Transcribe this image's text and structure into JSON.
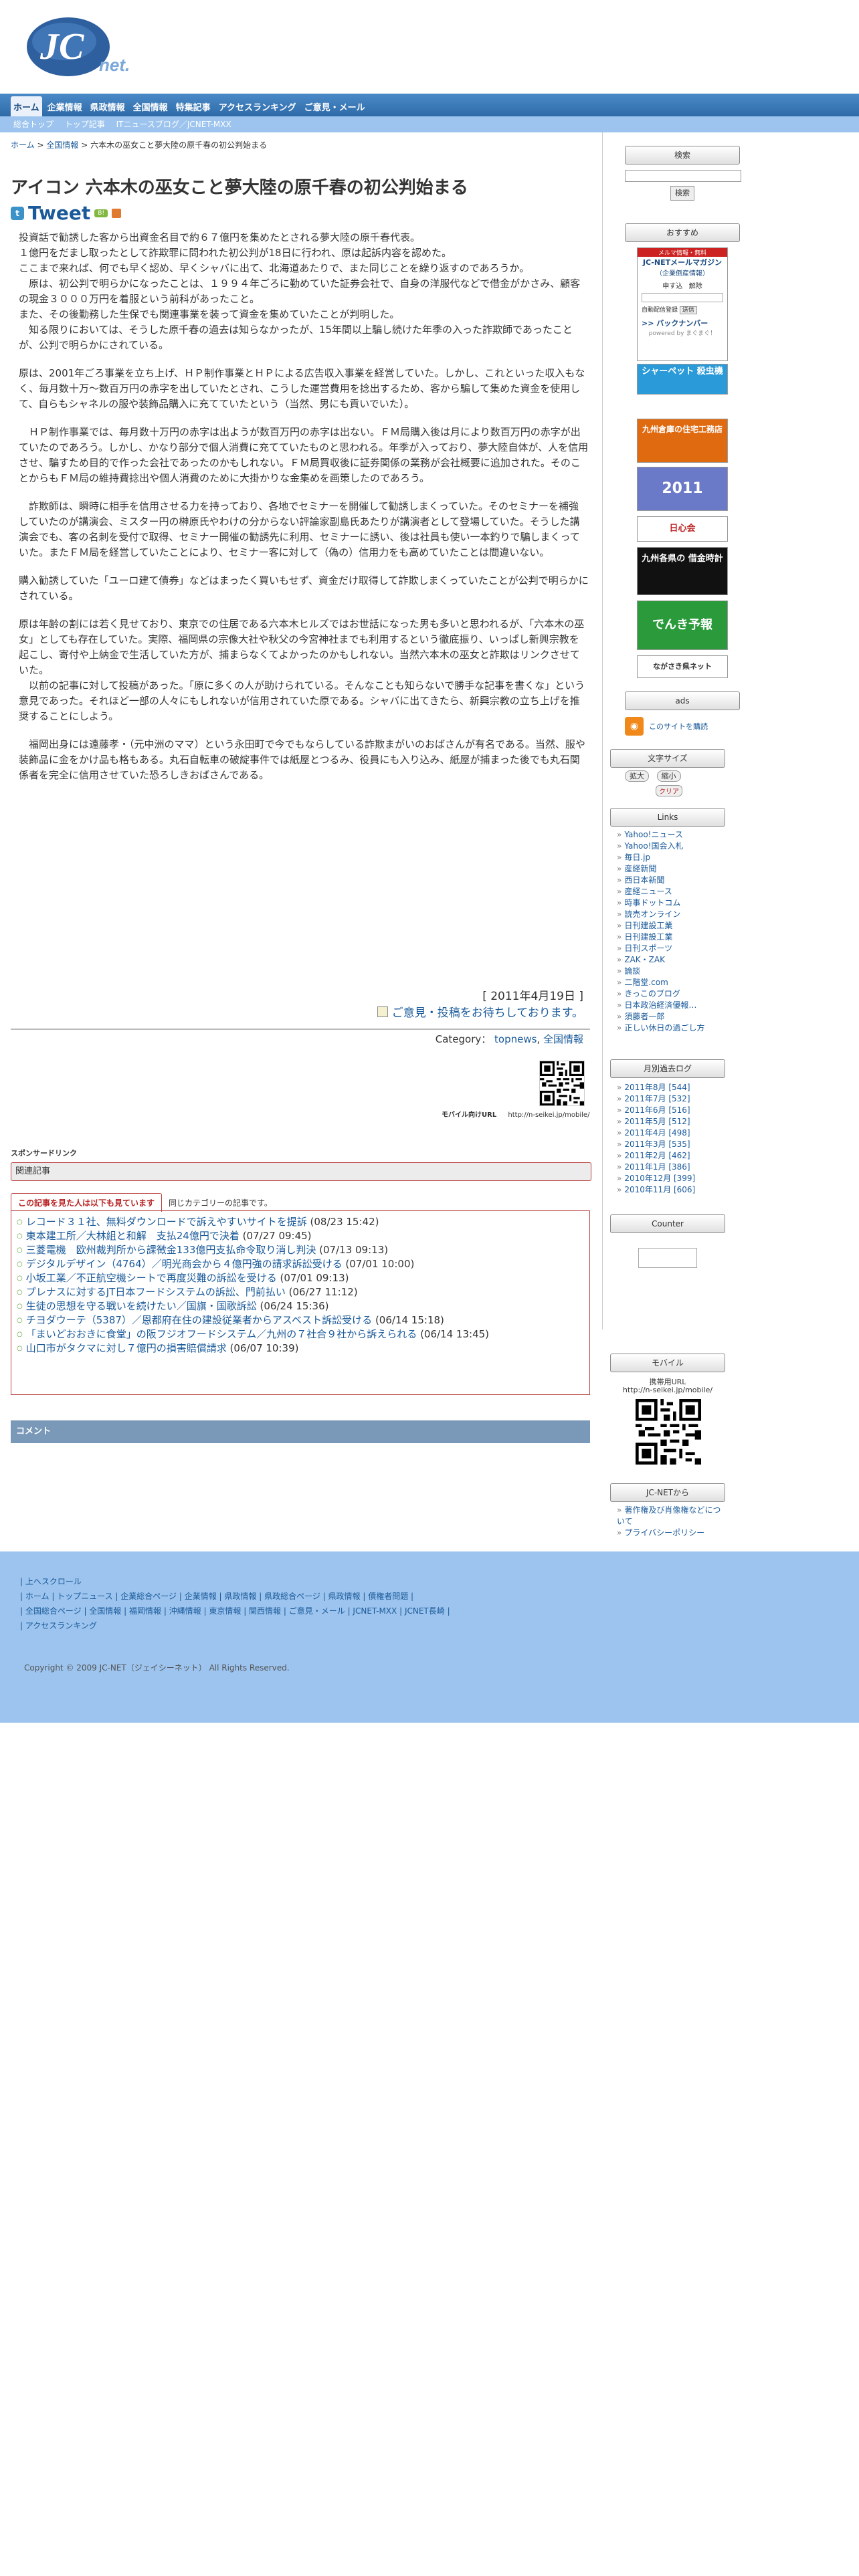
{
  "logo": {
    "text": "JC",
    "sub": "net."
  },
  "nav": {
    "items": [
      "ホーム",
      "企業情報",
      "県政情報",
      "全国情報",
      "特集記事",
      "アクセスランキング",
      "ご意見・メール"
    ]
  },
  "subnav": {
    "items": [
      "総合トップ",
      "トップ記事",
      "ITニュースブログ／JCNET-MXX"
    ]
  },
  "breadcrumb": {
    "home": "ホーム",
    "sep": ">",
    "cat": "全国情報",
    "current": "六本木の巫女こと夢大陸の原千春の初公判始まる"
  },
  "article": {
    "title": "アイコン 六本木の巫女こと夢大陸の原千春の初公判始まる",
    "tweet": "Tweet",
    "paragraphs": [
      "投資話で勧誘した客から出資金名目で約６７億円を集めたとされる夢大陸の原千春代表。\n１億円をだまし取ったとして詐欺罪に問われた初公判が18日に行われ、原は起訴内容を認めた。\nここまで来れば、何でも早く認め、早くシャバに出て、北海道あたりで、また同じことを繰り返すのであろうか。\n　原は、初公判で明らかになったことは、１９９４年ごろに勤めていた証券会社で、自身の洋服代などで借金がかさみ、顧客の現金３０００万円を着服という前科があったこと。\nまた、その後勤務した生保でも関連事業を装って資金を集めていたことが判明した。\n　知る限りにおいては、そうした原千春の過去は知らなかったが、15年間以上騙し続けた年季の入った詐欺師であったことが、公判で明らかにされている。",
      "原は、2001年ごろ事業を立ち上げ、ＨＰ制作事業とＨＰによる広告収入事業を経営していた。しかし、これといった収入もなく、毎月数十万〜数百万円の赤字を出していたとされ、こうした運営費用を捻出するため、客から騙して集めた資金を使用して、自らもシャネルの服や装飾品購入に充てていたという（当然、男にも貢いでいた）。",
      "　ＨＰ制作事業では、毎月数十万円の赤字は出ようが数百万円の赤字は出ない。ＦＭ局購入後は月により数百万円の赤字が出ていたのであろう。しかし、かなり部分で個人消費に充てていたものと思われる。年季が入っており、夢大陸自体が、人を信用させ、騙すため目的で作った会社であったのかもしれない。ＦＭ局買収後に証券関係の業務が会社概要に追加された。そのことからもＦＭ局の維持費捻出や個人消費のために大掛かりな金集めを画策したのであろう。",
      "　詐欺師は、瞬時に相手を信用させる力を持っており、各地でセミナーを開催して勧誘しまくっていた。そのセミナーを補強していたのが講演会、ミスター円の榊原氏やわけの分からない評論家副島氏あたりが講演者として登場していた。そうした講演会でも、客の名刺を受付で取得、セミナー開催の勧誘先に利用、セミナーに誘い、後は社員も使い一本釣りで騙しまくっていた。またＦＭ局を経営していたことにより、セミナー客に対して（偽の）信用力をも高めていたことは間違いない。",
      "購入勧誘していた「ユーロ建て債券」などはまったく買いもせず、資金だけ取得して詐欺しまくっていたことが公判で明らかにされている。",
      "原は年齢の割には若く見せており、東京での住居である六本木ヒルズではお世話になった男も多いと思われるが、「六本木の巫女」としても存在していた。実際、福岡県の宗像大社や秋父の今宮神社までも利用するという徹底振り、いっぱし新興宗教を起こし、寄付や上納金で生活していた方が、捕まらなくてよかったのかもしれない。当然六本木の巫女と詐欺はリンクさせていた。\n　以前の記事に対して投稿があった。「原に多くの人が助けられている。そんなことも知らないで勝手な記事を書くな」という意見であった。それほど一部の人々にもしれないが信用されていた原である。シャバに出てきたら、新興宗教の立ち上げを推奨することにしよう。",
      "　福岡出身には遠藤孝・（元中洲のママ）という永田町で今でもならしている詐欺まがいのおばさんが有名である。当然、服や装飾品に金をかけ品も格もある。丸石自転車の破綻事件では紙屋とつるみ、役員にも入り込み、紙屋が捕まった後でも丸石関係者を完全に信用させていた恐ろしきおばさんである。"
    ],
    "date": "[ 2011年4月19日 ]",
    "opinion": "ご意見・投稿をお待ちしております。",
    "category_label": "Category：",
    "categories": [
      "topnews",
      "全国情報"
    ],
    "mobile_label": "モバイル向けURL",
    "mobile_url": "http://n-seikei.jp/mobile/"
  },
  "sponsored": "スポンサードリンク",
  "related": {
    "header": "関連記事",
    "tab_active": "この記事を見た人は以下も見ています",
    "tab_other": "同じカテゴリーの記事です。",
    "items": [
      {
        "title": "レコード３１社、無料ダウンロードで訴えやすいサイトを提訴",
        "date": "(08/23 15:42)"
      },
      {
        "title": "東本建工所／大林組と和解　支払24億円で決着",
        "date": "(07/27 09:45)"
      },
      {
        "title": "三菱電機　欧州裁判所から課徴金133億円支払命令取り消し判決",
        "date": "(07/13 09:13)"
      },
      {
        "title": "デジタルデザイン（4764）／明光商会から４億円強の請求訴訟受ける",
        "date": "(07/01 10:00)"
      },
      {
        "title": "小坂工業／不正航空機シートで再度災難の訴訟を受ける",
        "date": "(07/01 09:13)"
      },
      {
        "title": "プレナスに対するJT日本フードシステムの訴訟、門前払い",
        "date": "(06/27 11:12)"
      },
      {
        "title": "生徒の思想を守る戦いを続けたい／国旗・国歌訴訟",
        "date": "(06/24 15:36)"
      },
      {
        "title": "チヨダウーテ（5387）／恩都府在住の建設従業者からアスベスト訴訟受ける",
        "date": "(06/14 15:18)"
      },
      {
        "title": "「まいどおおきに食堂」の阪フジオフードシステム／九州の７社合９社から訴えられる",
        "date": "(06/14 13:45)"
      },
      {
        "title": "山口市がタクマに対し７億円の損害賠償請求",
        "date": "(06/07 10:39)"
      }
    ]
  },
  "comment": "コメント",
  "sidebar": {
    "search_head": "検索",
    "search_button": "検索",
    "recommend_head": "おすすめ",
    "mailmag": {
      "line1": "メルマ情報・無料",
      "line2": "JC-NETメールマガジン",
      "line3": "（企業倒産情報）",
      "sub": "申す込",
      "unsub": "解除",
      "btn": "送信",
      "backnumber": ">> バックナンバー",
      "powered": "powered by まぐまぐ！",
      "check": "自動配信登録"
    },
    "banners": [
      "シャーペット 殺虫機",
      "九州倉庫の住宅工務店",
      "2011",
      "日心会",
      "九州各県の 借金時計",
      "でんき予報",
      "ながさき県ネット"
    ],
    "ads_head": "ads",
    "rss": "このサイトを購読",
    "font_head": "文字サイズ",
    "font_large": "拡大",
    "font_small": "縮小",
    "font_clear": "クリア",
    "links_head": "Links",
    "links": [
      "Yahoo!ニュース",
      "Yahoo!国会入札",
      "毎日.jp",
      "産経新聞",
      "西日本新聞",
      "産経ニュース",
      "時事ドットコム",
      "読売オンライン",
      "日刊建設工業",
      "日刊建設工業",
      "日刊スポーツ",
      "ZAK・ZAK",
      "論談",
      "二階堂.com",
      "きっこのブログ",
      "日本政治経済優報…",
      "須藤者一郎",
      "正しい休日の過ごし方"
    ],
    "monthly_head": "月別過去ログ",
    "monthly": [
      "2011年8月 [544]",
      "2011年7月 [532]",
      "2011年6月 [516]",
      "2011年5月 [512]",
      "2011年4月 [498]",
      "2011年3月 [535]",
      "2011年2月 [462]",
      "2011年1月 [386]",
      "2010年12月 [399]",
      "2010年11月 [606]"
    ],
    "counter_head": "Counter",
    "mobile_head": "モバイル",
    "mobile_label": "携帯用URL",
    "mobile_url": "http://n-seikei.jp/mobile/",
    "jcnet_head": "JC-NETから",
    "jcnet_items": [
      "著作権及び肖像権などについて",
      "プライバシーポリシー"
    ]
  },
  "footer": {
    "top": "上へスクロール",
    "line1": [
      "ホーム",
      "トップニュース",
      "企業総合ページ",
      "企業情報",
      "県政情報",
      "県政総合ページ",
      "県政情報",
      "債権者問題"
    ],
    "line2": [
      "全国総合ページ",
      "全国情報",
      "福岡情報",
      "沖縄情報",
      "東京情報",
      "関西情報",
      "ご意見・メール",
      "JCNET-MXX",
      "JCNET長崎"
    ],
    "line3": [
      "アクセスランキング"
    ],
    "copyright": "Copyright © 2009 JC-NET（ジェイシーネット） All Rights Reserved."
  },
  "colors": {
    "nav_blue": "#2f6aa8",
    "subnav_blue": "#9cc4ee",
    "link": "#1a5a9a",
    "related_border": "#b84040"
  }
}
